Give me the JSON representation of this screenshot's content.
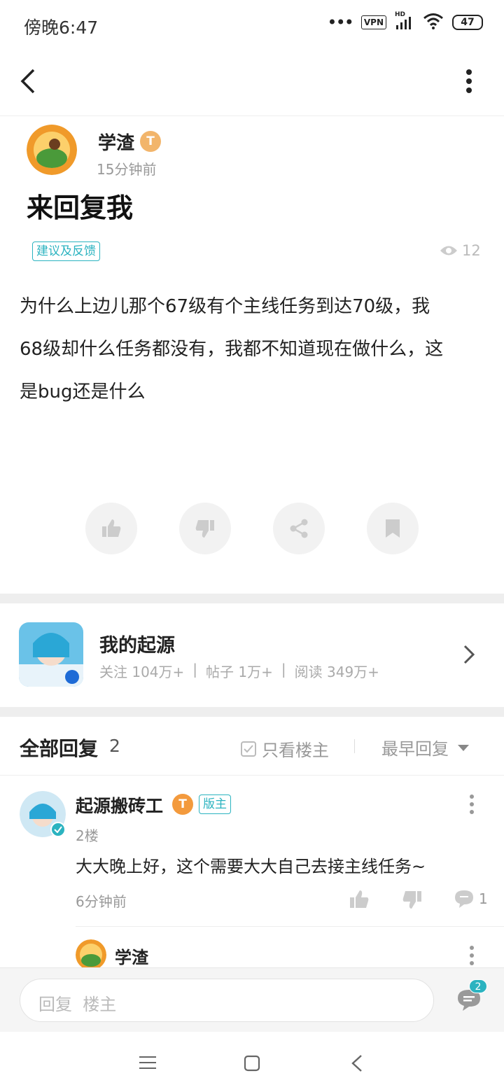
{
  "status_bar": {
    "time": "傍晚6:47",
    "vpn": "VPN",
    "hd": "HD",
    "battery": "47"
  },
  "post": {
    "author": "学渣",
    "author_badge": "T",
    "time": "15分钟前",
    "title": "来回复我",
    "tag": "建议及反馈",
    "views": "12",
    "body_lines": [
      "为什么上边儿那个67级有个主线任务到达70级，我",
      "68级却什么任务都没有，我都不知道现在做什么，这",
      "是bug还是什么"
    ]
  },
  "game": {
    "name": "我的起源",
    "stats": {
      "follow": "关注 104万+",
      "posts": "帖子 1万+",
      "reads": "阅读 349万+"
    },
    "sep": "|"
  },
  "replies_header": {
    "title": "全部回复",
    "count": "2",
    "only_op": "只看楼主",
    "sort": "最早回复"
  },
  "reply1": {
    "author": "起源搬砖工",
    "badge": "T",
    "role": "版主",
    "floor": "2楼",
    "content": "大大晚上好，这个需要大大自己去接主线任务~",
    "time": "6分钟前",
    "comment_count": "1"
  },
  "reply2": {
    "author": "学渣"
  },
  "bottom_bar": {
    "placeholder": "回复  楼主",
    "notif_count": "2"
  },
  "colors": {
    "accent": "#2bb3c0",
    "badge": "#f2b56b",
    "notif": "#2bb3c0"
  }
}
